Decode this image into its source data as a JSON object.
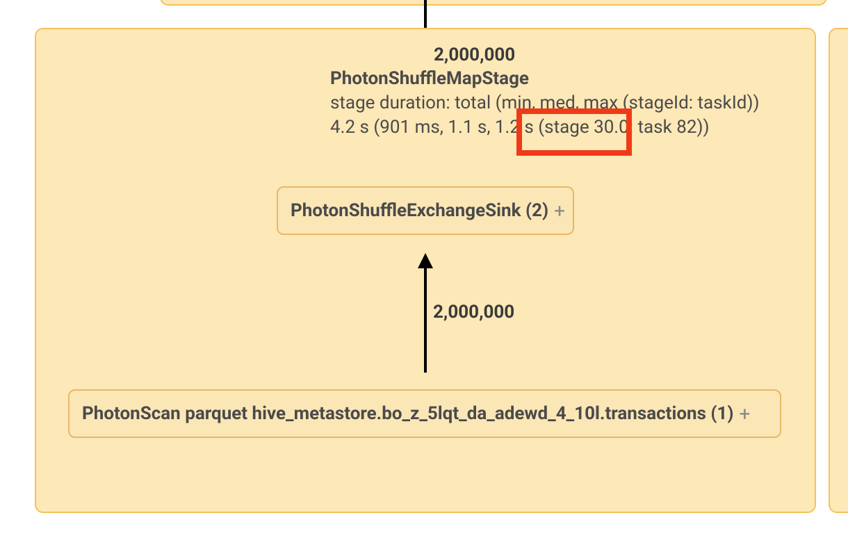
{
  "stage": {
    "title": "PhotonShuffleMapStage",
    "duration_label": "stage duration: total (min, med, max (stageId: taskId))",
    "duration_values": "4.2 s (901 ms, 1.1 s, 1.2 s (stage 30.0: task 82))"
  },
  "edges": {
    "top_rows": "2,000,000",
    "mid_rows": "2,000,000"
  },
  "nodes": {
    "sink": {
      "label": "PhotonShuffleExchangeSink (2)",
      "expand": "+"
    },
    "scan": {
      "label": "PhotonScan parquet hive_metastore.bo_z_5lqt_da_adewd_4_10l.transactions (1)",
      "expand": "+"
    }
  }
}
